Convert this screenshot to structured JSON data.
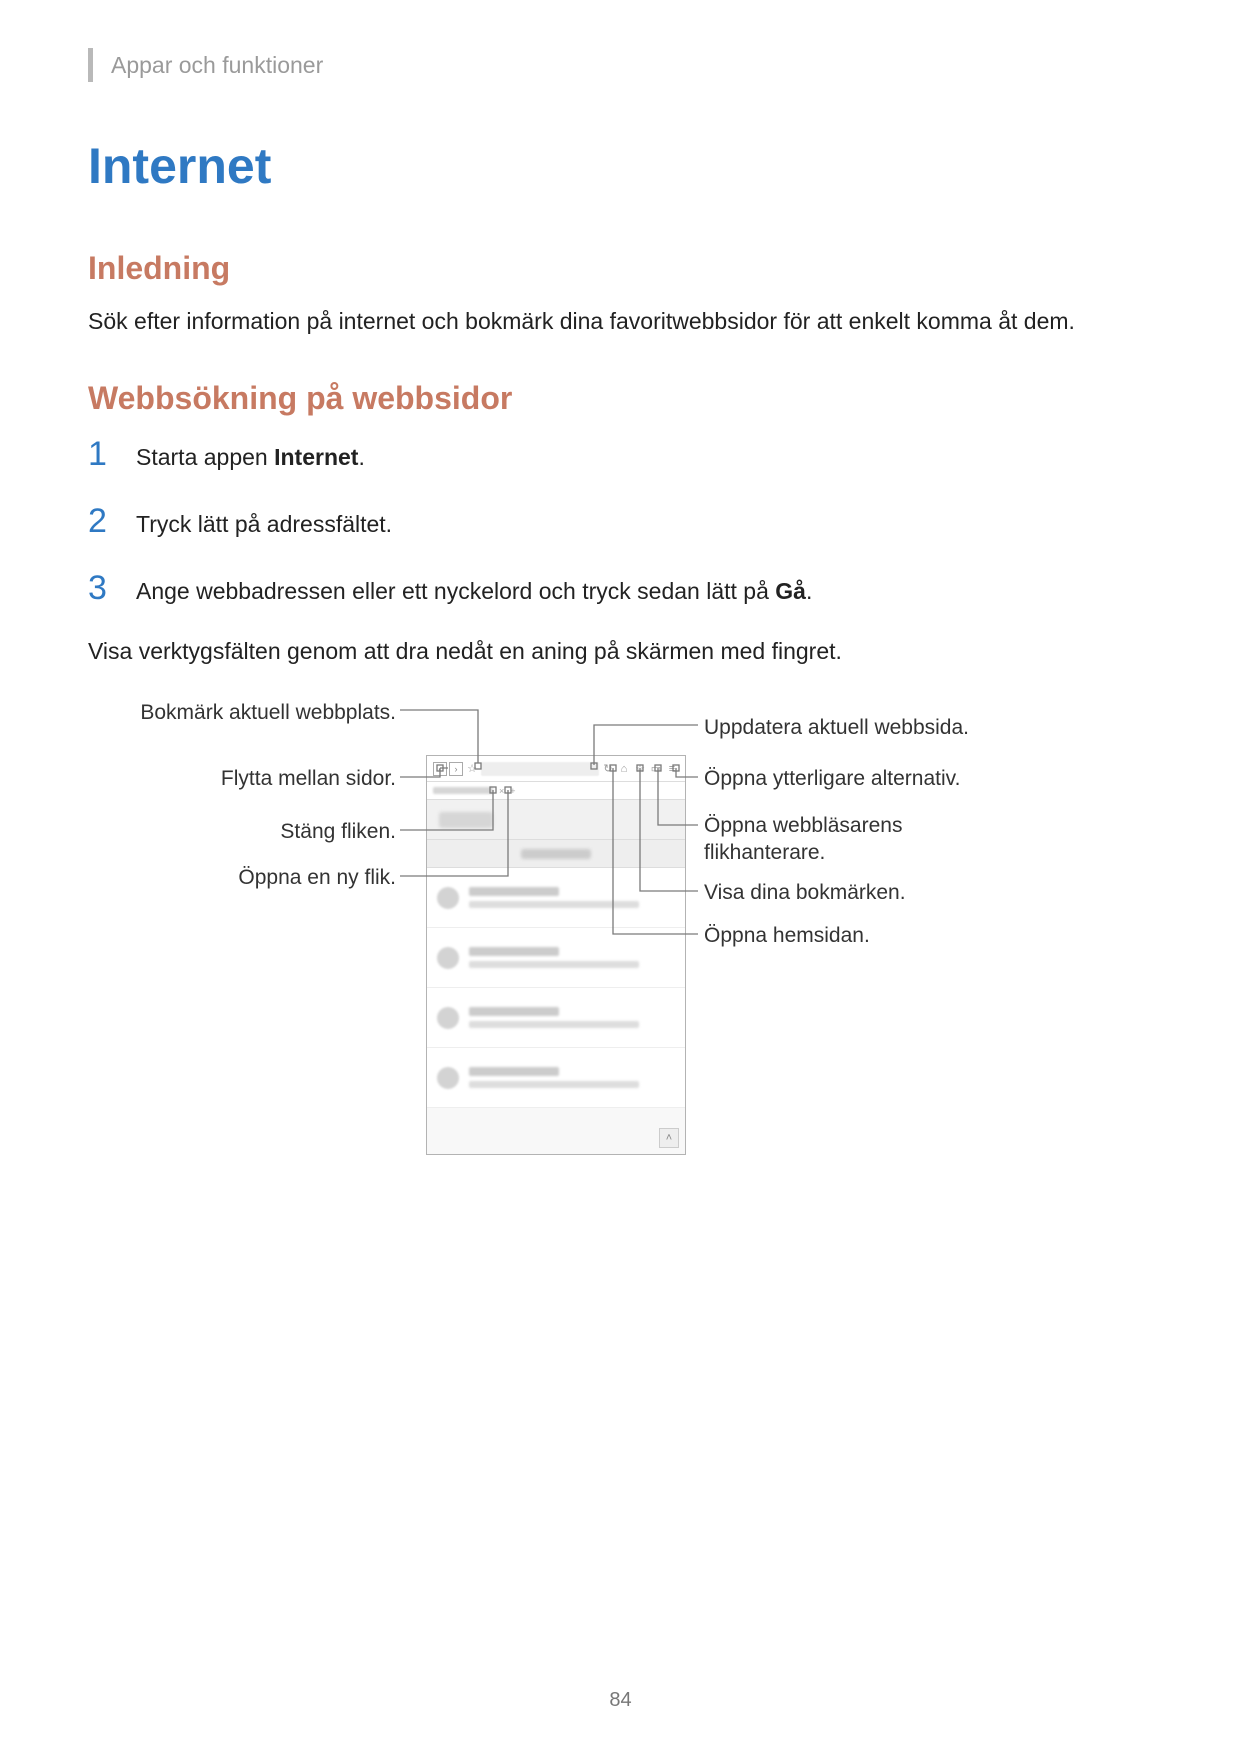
{
  "breadcrumb": "Appar och funktioner",
  "title": "Internet",
  "section_intro_heading": "Inledning",
  "section_intro_body": "Sök efter information på internet och bokmärk dina favoritwebbsidor för att enkelt komma åt dem.",
  "section_search_heading": "Webbsökning på webbsidor",
  "steps": [
    {
      "num": "1",
      "pre": "Starta appen ",
      "bold": "Internet",
      "post": "."
    },
    {
      "num": "2",
      "pre": "Tryck lätt på adressfältet.",
      "bold": "",
      "post": ""
    },
    {
      "num": "3",
      "pre": "Ange webbadressen eller ett nyckelord och tryck sedan lätt på ",
      "bold": "Gå",
      "post": "."
    }
  ],
  "toolbars_hint": "Visa verktygsfälten genom att dra nedåt en aning på skärmen med fingret.",
  "callouts": {
    "bookmark_current": "Bokmärk aktuell webbplats.",
    "move_between_pages": "Flytta mellan sidor.",
    "close_tab": "Stäng fliken.",
    "open_new_tab": "Öppna en ny flik.",
    "refresh_page": "Uppdatera aktuell webbsida.",
    "more_options": "Öppna ytterligare alternativ.",
    "tab_manager": "Öppna webbläsarens flikhanterare.",
    "show_bookmarks": "Visa dina bokmärken.",
    "open_homepage": "Öppna hemsidan."
  },
  "page_number": "84"
}
